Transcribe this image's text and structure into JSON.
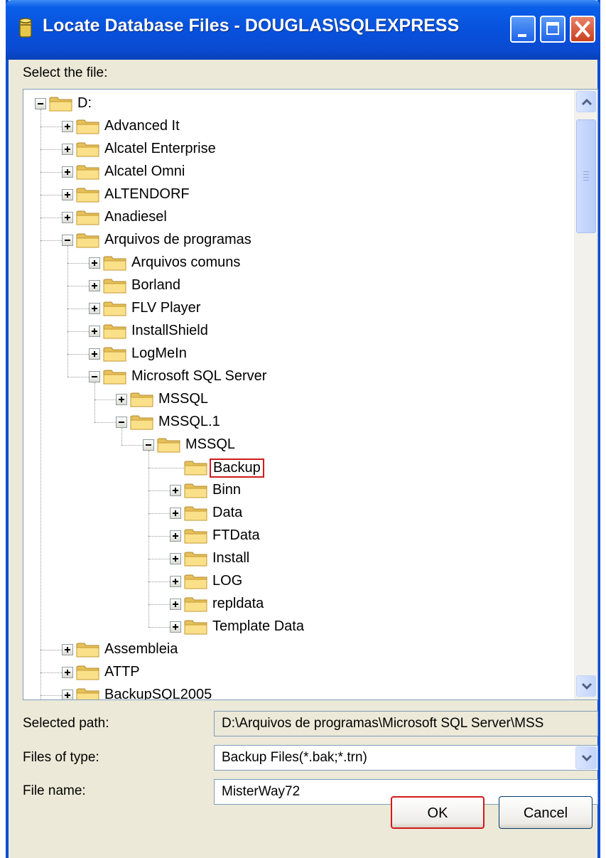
{
  "window": {
    "title": "Locate Database Files - DOUGLAS\\SQLEXPRESS"
  },
  "labels": {
    "select_file": "Select the file:",
    "selected_path": "Selected path:",
    "files_of_type": "Files of type:",
    "file_name": "File name:"
  },
  "tree": [
    {
      "label": "D:",
      "expanded": true
    },
    {
      "label": "Advanced It",
      "expanded": false
    },
    {
      "label": "Alcatel Enterprise",
      "expanded": false
    },
    {
      "label": "Alcatel Omni",
      "expanded": false
    },
    {
      "label": "ALTENDORF",
      "expanded": false
    },
    {
      "label": "Anadiesel",
      "expanded": false
    },
    {
      "label": "Arquivos de programas",
      "expanded": true
    },
    {
      "label": "Arquivos comuns",
      "expanded": false
    },
    {
      "label": "Borland",
      "expanded": false
    },
    {
      "label": "FLV Player",
      "expanded": false
    },
    {
      "label": "InstallShield",
      "expanded": false
    },
    {
      "label": "LogMeIn",
      "expanded": false
    },
    {
      "label": "Microsoft SQL Server",
      "expanded": true
    },
    {
      "label": "MSSQL",
      "expanded": false
    },
    {
      "label": "MSSQL.1",
      "expanded": true
    },
    {
      "label": "MSSQL",
      "expanded": true
    },
    {
      "label": "Backup",
      "selected": true
    },
    {
      "label": "Binn",
      "expanded": false
    },
    {
      "label": "Data",
      "expanded": false
    },
    {
      "label": "FTData",
      "expanded": false
    },
    {
      "label": "Install",
      "expanded": false
    },
    {
      "label": "LOG",
      "expanded": false
    },
    {
      "label": "repldata",
      "expanded": false
    },
    {
      "label": "Template Data",
      "expanded": false
    },
    {
      "label": "Assembleia",
      "expanded": false
    },
    {
      "label": "ATTP",
      "expanded": false
    },
    {
      "label": "BackupSQL2005",
      "expanded": false
    }
  ],
  "selected_path": "D:\\Arquivos de programas\\Microsoft SQL Server\\MSS",
  "files_of_type": "Backup Files(*.bak;*.trn)",
  "file_name": "MisterWay72",
  "buttons": {
    "ok": "OK",
    "cancel": "Cancel"
  },
  "colors": {
    "titlebar": "#0751dc",
    "selection_outline": "#d21a1a",
    "dialog_bg": "#ece9d8"
  }
}
